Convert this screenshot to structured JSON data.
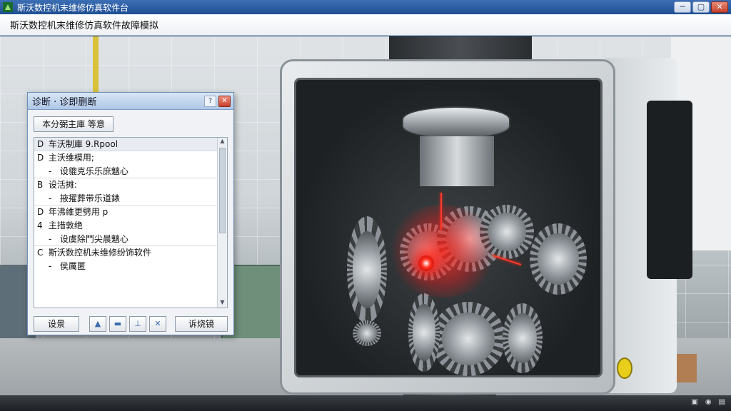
{
  "window": {
    "title": "斯沃数控机末维修仿真软件台",
    "heading": "斯沃数控机末维修仿真软件故障模拟",
    "controls": {
      "minimize": "─",
      "maximize": "▢",
      "close": "✕"
    }
  },
  "dialog": {
    "title": "诊断 · 诊即删断",
    "title_buttons": {
      "help": "?",
      "close": "✕"
    },
    "tab_label": "本分弼主庫 等意",
    "tree": [
      {
        "marker": "D",
        "text": "车沃制庫 9.Rpool",
        "level": 0
      },
      {
        "marker": "D",
        "text": "主沃维模用;",
        "level": 0
      },
      {
        "marker": "-",
        "text": "设貔克乐乐庶魑心",
        "level": 1
      },
      {
        "marker": "B",
        "text": "设活摊:",
        "level": 0
      },
      {
        "marker": "-",
        "text": "掖擢葬带乐道錶",
        "level": 1
      },
      {
        "marker": "D",
        "text": "年沸維更劈用 p",
        "level": 0
      },
      {
        "marker": "4",
        "text": "主措敦绝",
        "level": 0
      },
      {
        "marker": "-",
        "text": "设虞除鬥尖晨魑心",
        "level": 1
      },
      {
        "marker": "C",
        "text": "斯沃数控机未维修纷饰软件",
        "level": 0
      },
      {
        "marker": "-",
        "text": "侯厲匿",
        "level": 1
      }
    ],
    "buttons": {
      "settings": "设景",
      "confirm": "诉烧镜"
    },
    "toolbar_icons": [
      "user-icon",
      "minus-icon",
      "up-icon",
      "delete-icon"
    ]
  },
  "colors": {
    "titlebar": "#1f4f93",
    "fault_highlight": "#ff3020",
    "dialog_title": "#aec7e6"
  }
}
